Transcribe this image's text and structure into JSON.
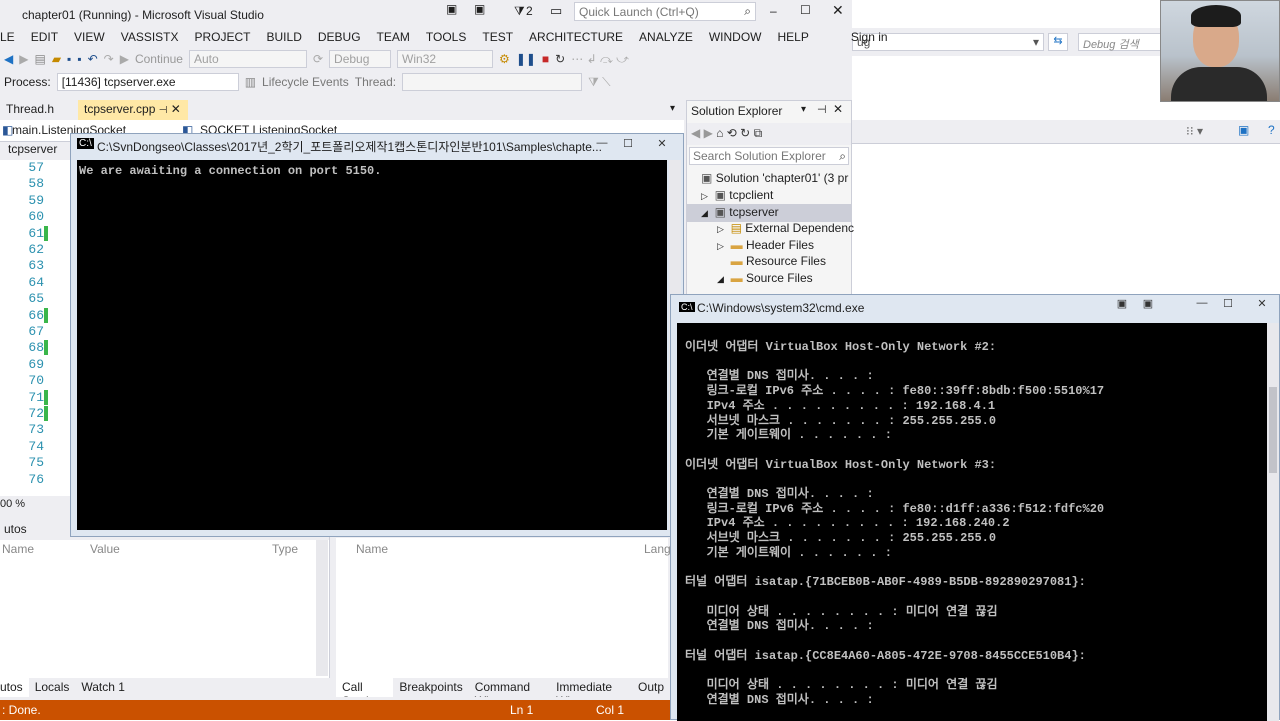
{
  "vs": {
    "title": "chapter01 (Running) - Microsoft Visual Studio",
    "filter_count": "2",
    "quick_launch_placeholder": "Quick Launch (Ctrl+Q)",
    "sign_in": "Sign in",
    "menu": [
      "LE",
      "EDIT",
      "VIEW",
      "VASSISTX",
      "PROJECT",
      "BUILD",
      "DEBUG",
      "TEAM",
      "TOOLS",
      "TEST",
      "ARCHITECTURE",
      "ANALYZE",
      "WINDOW",
      "HELP"
    ],
    "toolbar": {
      "continue_label": "Continue",
      "config1": "Auto",
      "config2": "Debug",
      "platform": "Win32"
    },
    "process_bar": {
      "process_label": "Process:",
      "process_value": "[11436] tcpserver.exe",
      "lifecycle_label": "Lifecycle Events",
      "thread_label": "Thread:"
    },
    "doc_tabs": [
      "Thread.h",
      "tcpserver.cpp"
    ],
    "nav": {
      "left": "main.ListeningSocket",
      "right": "SOCKET ListeningSocket",
      "project": "tcpserver"
    },
    "line_numbers": [
      "57",
      "58",
      "59",
      "60",
      "61",
      "62",
      "63",
      "64",
      "65",
      "66",
      "67",
      "68",
      "69",
      "70",
      "71",
      "72",
      "73",
      "74",
      "75",
      "76"
    ],
    "zoom": "00 %",
    "autos": {
      "title": "utos",
      "col_name": "Name",
      "col_value": "Value",
      "col_type": "Type"
    },
    "callstack": {
      "col_name": "Name",
      "col_lang": "Lang"
    },
    "bottom_tabs_left": [
      "utos",
      "Locals",
      "Watch 1"
    ],
    "bottom_tabs_right": [
      "Call Stack",
      "Breakpoints",
      "Command Wi...",
      "Immediate Wi...",
      "Outp"
    ],
    "status": {
      "left": ": Done.",
      "ln": "Ln 1",
      "col": "Col 1"
    }
  },
  "solution_explorer": {
    "title": "Solution Explorer",
    "search_placeholder": "Search Solution Explorer",
    "items": [
      "Solution 'chapter01' (3 pr",
      "tcpclient",
      "tcpserver",
      "External Dependenc",
      "Header Files",
      "Resource Files",
      "Source Files"
    ]
  },
  "right_toolbar": {
    "combo_text": "ug",
    "search_text": "Debug 검색"
  },
  "console1": {
    "title": "C:\\SvnDongseo\\Classes\\2017년_2학기_포트폴리오제작1캡스톤디자인분반101\\Samples\\chapte...",
    "output": "We are awaiting a connection on port 5150."
  },
  "console2": {
    "title": "C:\\Windows\\system32\\cmd.exe",
    "lines": [
      "이더넷 어댑터 VirtualBox Host-Only Network #2:",
      "",
      "   연결별 DNS 접미사. . . . :",
      "   링크-로컬 IPv6 주소 . . . . : fe80::39ff:8bdb:f500:5510%17",
      "   IPv4 주소 . . . . . . . . . : 192.168.4.1",
      "   서브넷 마스크 . . . . . . . : 255.255.255.0",
      "   기본 게이트웨이 . . . . . . :",
      "",
      "이더넷 어댑터 VirtualBox Host-Only Network #3:",
      "",
      "   연결별 DNS 접미사. . . . :",
      "   링크-로컬 IPv6 주소 . . . . : fe80::d1ff:a336:f512:fdfc%20",
      "   IPv4 주소 . . . . . . . . . : 192.168.240.2",
      "   서브넷 마스크 . . . . . . . : 255.255.255.0",
      "   기본 게이트웨이 . . . . . . :",
      "",
      "터널 어댑터 isatap.{71BCEB0B-AB0F-4989-B5DB-892890297081}:",
      "",
      "   미디어 상태 . . . . . . . . : 미디어 연결 끊김",
      "   연결별 DNS 접미사. . . . :",
      "",
      "터널 어댑터 isatap.{CC8E4A60-A805-472E-9708-8455CCE510B4}:",
      "",
      "   미디어 상태 . . . . . . . . : 미디어 연결 끊김",
      "   연결별 DNS 접미사. . . . :"
    ]
  },
  "colors": {
    "status_bar": "#ca5100",
    "active_tab": "#ffe8a6",
    "line_number": "#2b91af",
    "change_marker": "#3ab64a"
  }
}
